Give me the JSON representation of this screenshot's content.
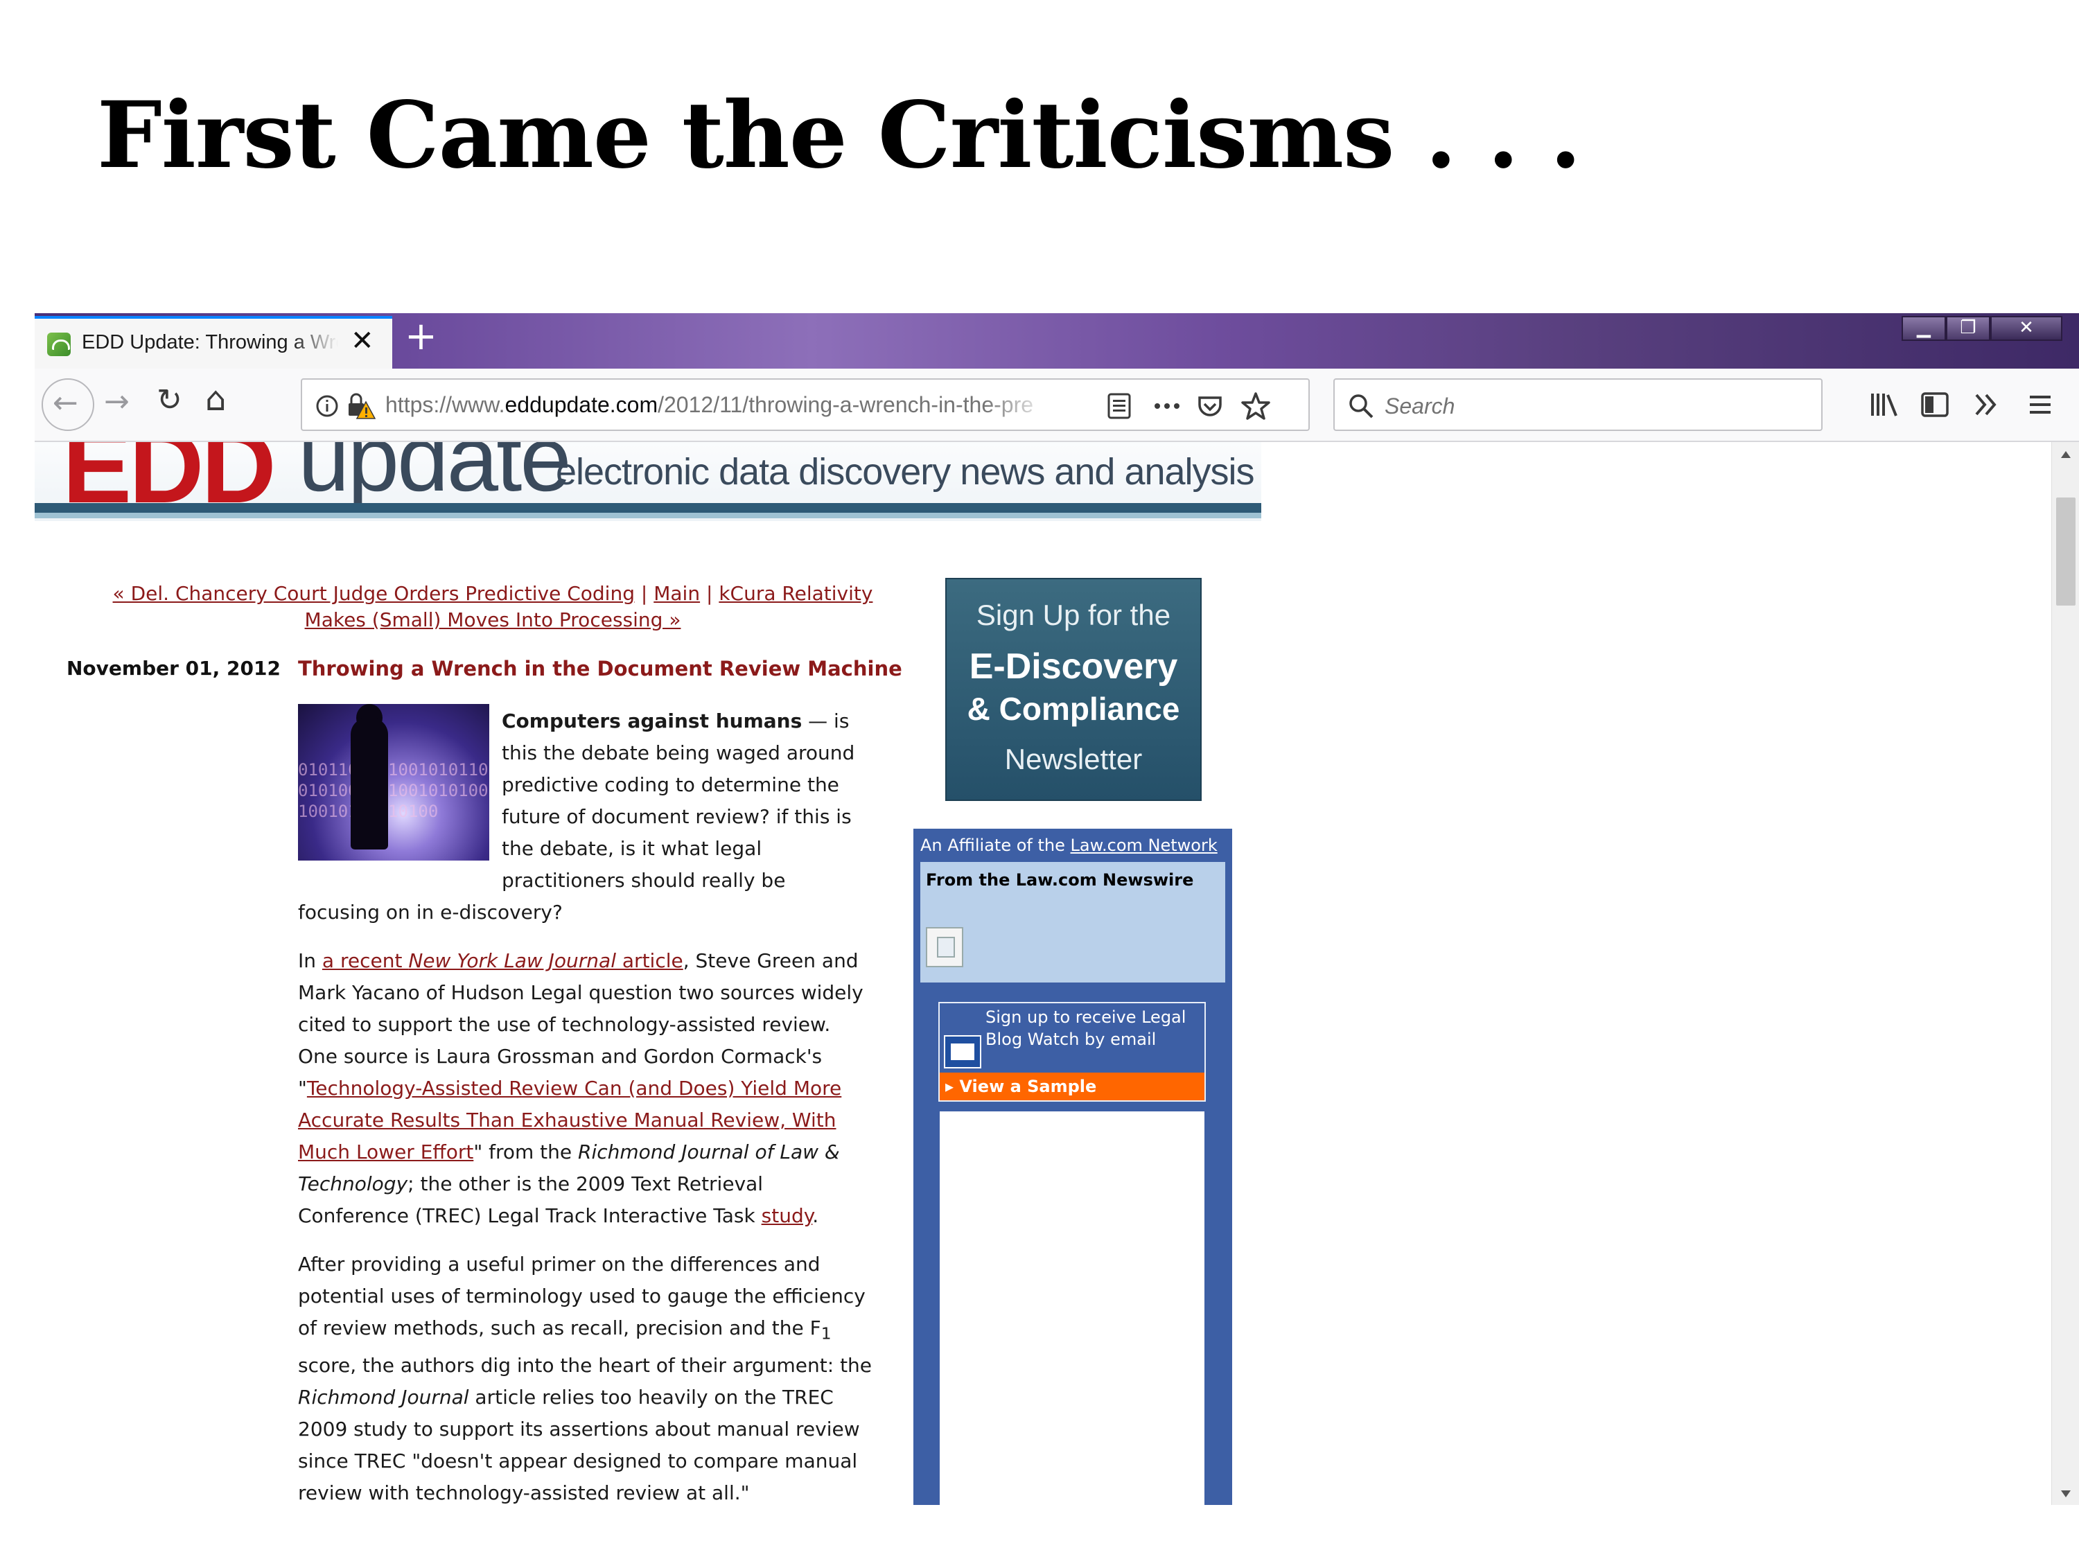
{
  "slide": {
    "title": "First Came the Criticisms . . ."
  },
  "browser": {
    "tab": {
      "title": "EDD Update: Throwing a Wrench in the Document Review Machine",
      "close": "✕",
      "new_tab": "+"
    },
    "window_controls": {
      "minimize": "▁",
      "restore": "❐",
      "close": "✕"
    },
    "nav": {
      "back": "←",
      "forward": "→",
      "reload": "↻",
      "home": "⌂"
    },
    "url": {
      "prefix": "https://www.",
      "host": "eddupdate.com",
      "path": "/2012/11/throwing-a-wrench-in-the-pre"
    },
    "search": {
      "placeholder": "Search"
    },
    "icons": {
      "info": "info-icon",
      "insecure-lock": "lock-warning-icon",
      "reader": "reader-view-icon",
      "more": "page-actions-icon",
      "pocket": "pocket-icon",
      "bookmark": "star-icon",
      "library": "library-icon",
      "sidebar": "sidebar-icon",
      "overflow": "overflow-icon",
      "menu": "hamburger-menu-icon"
    }
  },
  "site": {
    "banner": {
      "logo_left": "EDD",
      "logo_right": "update",
      "tagline": "electronic data discovery news and analysis"
    },
    "post_nav": {
      "prev_label": "« Del. Chancery Court Judge Orders Predictive Coding",
      "separator": "|",
      "main_label": "Main",
      "next_label": "kCura Relativity Makes (Small) Moves Into Processing »"
    },
    "post": {
      "date": "November 01, 2012",
      "title": "Throwing a Wrench in the Document Review Machine",
      "p1_bold": "Computers against humans",
      "p1_rest": " — is this the debate being waged around predictive coding to determine the future of document review? if this is the debate, is it what legal practitioners should really be focusing on in e-discovery?",
      "p2_a": "In ",
      "p2_link1_a": "a recent ",
      "p2_link1_i": "New York Law Journal",
      "p2_link1_b": " article",
      "p2_b": ", Steve Green and Mark Yacano of Hudson Legal question two sources widely cited to support the use of technology-assisted review. One source is Laura Grossman and Gordon Cormack's \"",
      "p2_link2": "Technology-Assisted Review Can (and Does) Yield More Accurate Results Than Exhaustive Manual Review, With Much Lower Effort",
      "p2_c": "\" from the ",
      "p2_i": "Richmond Journal of Law & Technology",
      "p2_d": "; the other is the 2009 Text Retrieval Conference (TREC) Legal Track Interactive Task ",
      "p2_link3": "study",
      "p2_e": ".",
      "p3_a": "After providing a useful primer on the differences and potential uses of terminology used to gauge the efficiency of review methods, such as recall, precision and the F",
      "p3_sub": "1",
      "p3_b": " score, the authors dig into the heart of their argument: the ",
      "p3_i": "Richmond Journal",
      "p3_c": " article relies too heavily on the TREC 2009 study to support its assertions about manual review since TREC \"doesn't appear designed to compare manual review with technology-assisted review at all.\""
    },
    "newsletter_ad": {
      "line1": "Sign Up for the",
      "line2": "E-Discovery",
      "line3": "& Compliance",
      "line4": "Newsletter"
    },
    "affiliate": {
      "header_prefix": "An Affiliate of the ",
      "header_link": "Law.com Network",
      "newswire_title": "From the Law.com Newswire",
      "signup_text": "Sign up to receive Legal Blog Watch by email",
      "view_sample": "View a Sample",
      "view_sample_arrow": "▸"
    }
  }
}
